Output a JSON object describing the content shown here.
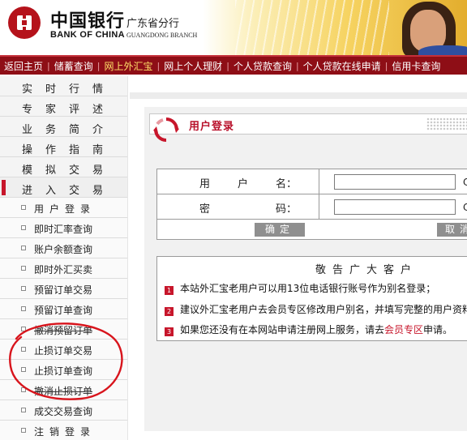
{
  "header": {
    "bank_name_cn": "中国银行",
    "bank_name_en": "BANK OF CHINA",
    "branch_cn": "广东省分行",
    "branch_en": "GUANGDONG BRANCH"
  },
  "nav": {
    "items": [
      {
        "label": "返回主页"
      },
      {
        "label": "储蓄查询"
      },
      {
        "label": "网上外汇宝",
        "active": true
      },
      {
        "label": "网上个人理财"
      },
      {
        "label": "个人贷款查询"
      },
      {
        "label": "个人贷款在线申请"
      },
      {
        "label": "信用卡查询"
      }
    ],
    "separator": "|"
  },
  "sidebar": {
    "top_items": [
      {
        "chars": [
          "实",
          "时",
          "行",
          "情"
        ]
      },
      {
        "chars": [
          "专",
          "家",
          "评",
          "述"
        ]
      },
      {
        "chars": [
          "业",
          "务",
          "简",
          "介"
        ]
      },
      {
        "chars": [
          "操",
          "作",
          "指",
          "南"
        ]
      },
      {
        "chars": [
          "模",
          "拟",
          "交",
          "易"
        ]
      },
      {
        "chars": [
          "进",
          "入",
          "交",
          "易"
        ],
        "current": true
      }
    ],
    "sub_items": [
      {
        "label": "用户登录",
        "spaced": true
      },
      {
        "label": "即时汇率查询"
      },
      {
        "label": "账户余额查询"
      },
      {
        "label": "即时外汇买卖"
      },
      {
        "label": "预留订单交易"
      },
      {
        "label": "预留订单查询"
      },
      {
        "label": "撤消预留订单",
        "struck": true
      },
      {
        "label": "止损订单交易"
      },
      {
        "label": "止损订单查询"
      },
      {
        "label": "撤消止损订单",
        "struck": true
      },
      {
        "label": "成交交易查询"
      },
      {
        "label": "注销登录",
        "spaced": true
      }
    ]
  },
  "login": {
    "title": "用户登录",
    "username_label_chars": [
      "用",
      "户",
      "名："
    ],
    "password_label_chars": [
      "密",
      "码："
    ],
    "username_value": "",
    "password_value": "",
    "username_trailing": "C",
    "password_trailing": "C",
    "ok_label": "确定",
    "cancel_label": "取消"
  },
  "notice": {
    "title": "敬告广大客户",
    "items": [
      {
        "num": "1",
        "text": "本站外汇宝老用户可以用13位电话银行账号作为别名登录；"
      },
      {
        "num": "2",
        "text": "建议外汇宝老用户去会员专区修改用户别名，并填写完整的用户资料"
      },
      {
        "num": "3",
        "text_before": "如果您还没有在本网站申请注册网上服务，请去",
        "link": "会员专区",
        "text_after": "申请。"
      }
    ]
  },
  "colors": {
    "brand_red": "#8e0e16",
    "accent_red": "#c7162b",
    "nav_active": "#ffe06a",
    "annotation_red": "#d8141c"
  }
}
